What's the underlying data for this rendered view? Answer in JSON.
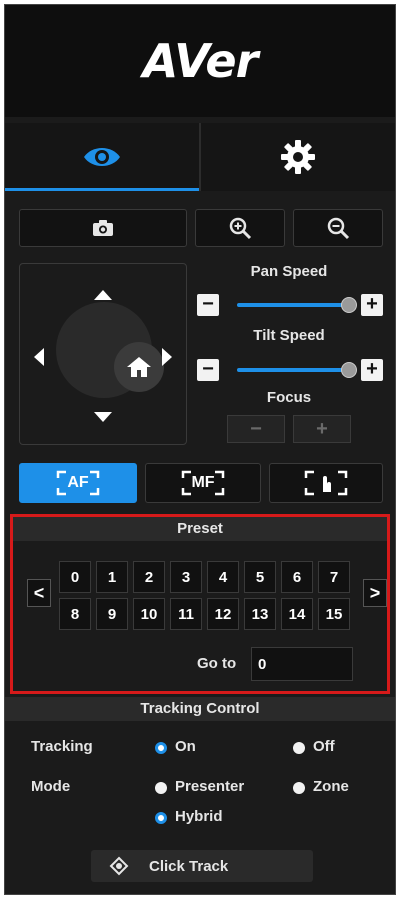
{
  "brand": {
    "logo_text": "AVer"
  },
  "tabs": [
    {
      "name": "camera",
      "icon": "eye-icon",
      "active": true
    },
    {
      "name": "settings",
      "icon": "gear-icon",
      "active": false
    }
  ],
  "toolbar": {
    "snapshot_icon": "camera-icon",
    "zoom_in_icon": "zoom-in-icon",
    "zoom_out_icon": "zoom-out-icon"
  },
  "ptz": {
    "pan_speed_label": "Pan Speed",
    "pan_speed_value": 1.0,
    "tilt_speed_label": "Tilt Speed",
    "tilt_speed_value": 1.0,
    "focus_label": "Focus",
    "focus_minus": "−",
    "focus_plus": "+",
    "minus": "−",
    "plus": "+"
  },
  "focus_modes": [
    {
      "label": "AF",
      "active": true
    },
    {
      "label": "MF",
      "active": false
    },
    {
      "label": "touch-focus",
      "active": false
    }
  ],
  "preset": {
    "title": "Preset",
    "numbers": [
      "0",
      "1",
      "2",
      "3",
      "4",
      "5",
      "6",
      "7",
      "8",
      "9",
      "10",
      "11",
      "12",
      "13",
      "14",
      "15"
    ],
    "prev": "<",
    "next": ">",
    "goto_label": "Go to",
    "goto_value": "0"
  },
  "tracking_control": {
    "title": "Tracking Control",
    "tracking_label": "Tracking",
    "on_label": "On",
    "off_label": "Off",
    "tracking_value": "On",
    "mode_label": "Mode",
    "presenter_label": "Presenter",
    "zone_label": "Zone",
    "hybrid_label": "Hybrid",
    "mode_value": "Hybrid",
    "click_track_label": "Click Track"
  },
  "colors": {
    "accent": "#1e90e8",
    "highlight_border": "#d61a1a",
    "background": "#1b1b1b"
  }
}
